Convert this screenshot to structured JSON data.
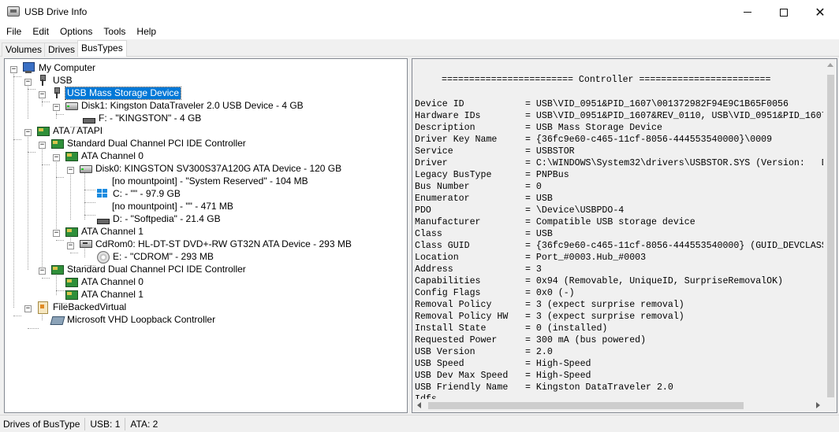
{
  "window": {
    "title": "USB Drive Info",
    "minimize_glyph": "",
    "close_glyph": "✕"
  },
  "menu": [
    "File",
    "Edit",
    "Options",
    "Tools",
    "Help"
  ],
  "tabs": [
    {
      "label": "Volumes",
      "active": false
    },
    {
      "label": "Drives",
      "active": false
    },
    {
      "label": "BusTypes",
      "active": true
    }
  ],
  "tree": [
    {
      "label": "My Computer",
      "icon": "computer-icon",
      "expander": "−"
    },
    {
      "label": "USB",
      "icon": "usb-icon",
      "expander": "−"
    },
    {
      "label": "USB Mass Storage Device",
      "icon": "usb-icon",
      "expander": "−",
      "selected": true
    },
    {
      "label": "Disk1: Kingston DataTraveler 2.0 USB Device - 4 GB",
      "icon": "drive-icon",
      "expander": "−"
    },
    {
      "label": "F: - \"KINGSTON\" - 4 GB",
      "icon": "flat-drive-icon"
    },
    {
      "label": "ATA / ATAPI",
      "icon": "controller-card-icon",
      "expander": "−"
    },
    {
      "label": "Standard Dual Channel PCI IDE Controller",
      "icon": "controller-card-icon",
      "expander": "−"
    },
    {
      "label": "ATA Channel 0",
      "icon": "controller-card-icon",
      "expander": "−"
    },
    {
      "label": "Disk0: KINGSTON SV300S37A120G ATA Device - 120 GB",
      "icon": "drive-icon",
      "expander": "−"
    },
    {
      "label": "[no mountpoint] - \"System Reserved\" - 104 MB",
      "icon": ""
    },
    {
      "label": "C: - \"\" - 97.9 GB",
      "icon": "windows-drive-icon"
    },
    {
      "label": "[no mountpoint] - \"\" - 471 MB",
      "icon": ""
    },
    {
      "label": "D: - \"Softpedia\" - 21.4 GB",
      "icon": "flat-drive-icon"
    },
    {
      "label": "ATA Channel 1",
      "icon": "controller-card-icon",
      "expander": "−"
    },
    {
      "label": "CdRom0: HL-DT-ST DVD+-RW GT32N ATA Device - 293 MB",
      "icon": "cdrom-icon",
      "expander": "−"
    },
    {
      "label": "E: - \"CDROM\" - 293 MB",
      "icon": "disc-icon"
    },
    {
      "label": "Standard Dual Channel PCI IDE Controller",
      "icon": "controller-card-icon",
      "expander": "−"
    },
    {
      "label": "ATA Channel 0",
      "icon": "controller-card-icon"
    },
    {
      "label": "ATA Channel 1",
      "icon": "controller-card-icon"
    },
    {
      "label": "FileBackedVirtual",
      "icon": "virtual-bus-icon",
      "expander": "−"
    },
    {
      "label": "Microsoft VHD Loopback Controller",
      "icon": "loopback-controller-icon"
    }
  ],
  "details": {
    "heading": "======================== Controller ========================",
    "properties": [
      [
        "Device ID",
        "= USB\\VID_0951&PID_1607\\001372982F94E9C1B65F0056"
      ],
      [
        "Hardware IDs",
        "= USB\\VID_0951&PID_1607&REV_0110, USB\\VID_0951&PID_1607"
      ],
      [
        "Description",
        "= USB Mass Storage Device"
      ],
      [
        "Driver Key Name",
        "= {36fc9e60-c465-11cf-8056-444553540000}\\0009"
      ],
      [
        "Service",
        "= USBSTOR"
      ],
      [
        "Driver",
        "= C:\\WINDOWS\\System32\\drivers\\USBSTOR.SYS (Version:   Da"
      ],
      [
        "Legacy BusType",
        "= PNPBus"
      ],
      [
        "Bus Number",
        "= 0"
      ],
      [
        "Enumerator",
        "= USB"
      ],
      [
        "PDO",
        "= \\Device\\USBPDO-4"
      ],
      [
        "Manufacturer",
        "= Compatible USB storage device"
      ],
      [
        "Class",
        "= USB"
      ],
      [
        "Class GUID",
        "= {36fc9e60-c465-11cf-8056-444553540000} (GUID_DEVCLASS_"
      ],
      [
        "Location",
        "= Port_#0003.Hub_#0003"
      ],
      [
        "Address",
        "= 3"
      ],
      [
        "Capabilities",
        "= 0x94 (Removable, UniqueID, SurpriseRemovalOK)"
      ],
      [
        "Config Flags",
        "= 0x0 (-)"
      ],
      [
        "Removal Policy",
        "= 3 (expect surprise removal)"
      ],
      [
        "Removal Policy HW",
        "= 3 (expect surprise removal)"
      ],
      [
        "Install State",
        "= 0 (installed)"
      ],
      [
        "Requested Power",
        "= 300 mA (bus powered)"
      ],
      [
        "USB Version",
        "= 2.0"
      ],
      [
        "USB Speed",
        "= High-Speed"
      ],
      [
        "USB Dev Max Speed",
        "= High-Speed"
      ],
      [
        "USB Friendly Name",
        "= Kingston DataTraveler 2.0"
      ],
      [
        "Idfs",
        ""
      ]
    ]
  },
  "status": {
    "label": "Drives of BusType",
    "usb": "USB: 1",
    "ata": "ATA: 2"
  },
  "colors": {
    "selection": "#0078d7",
    "panel_bg": "#f0f0f0",
    "window_bg": "#ffffff"
  }
}
